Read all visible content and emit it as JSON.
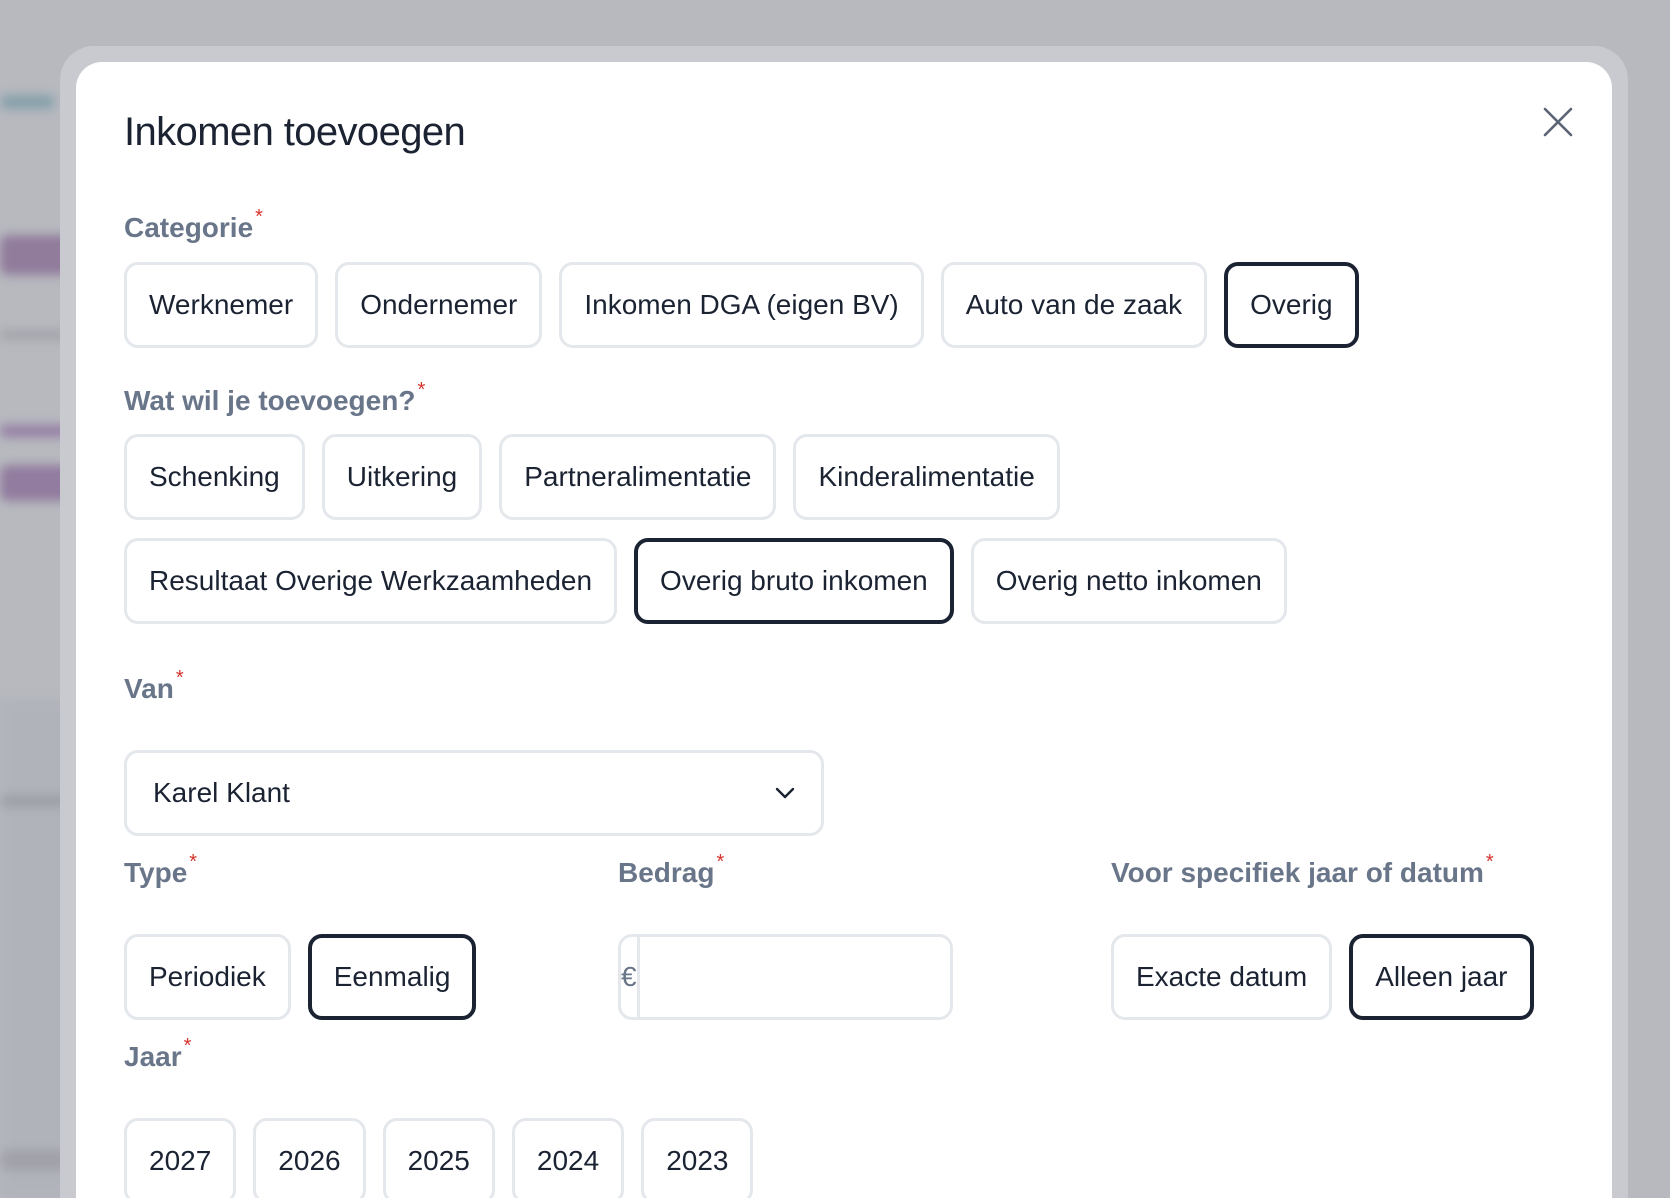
{
  "modal": {
    "title": "Inkomen toevoegen",
    "required_mark": "*"
  },
  "categorie": {
    "label": "Categorie",
    "options": [
      "Werknemer",
      "Ondernemer",
      "Inkomen DGA (eigen BV)",
      "Auto van de zaak",
      "Overig"
    ],
    "selected": "Overig"
  },
  "wat": {
    "label": "Wat wil je toevoegen?",
    "options": [
      "Schenking",
      "Uitkering",
      "Partneralimentatie",
      "Kinderalimentatie",
      "Resultaat Overige Werkzaamheden",
      "Overig bruto inkomen",
      "Overig netto inkomen"
    ],
    "selected": "Overig bruto inkomen"
  },
  "van": {
    "label": "Van",
    "value": "Karel Klant"
  },
  "type": {
    "label": "Type",
    "options": [
      "Periodiek",
      "Eenmalig"
    ],
    "selected": "Eenmalig"
  },
  "bedrag": {
    "label": "Bedrag",
    "prefix": "€",
    "value": ""
  },
  "specifiek": {
    "label": "Voor specifiek jaar of datum",
    "options": [
      "Exacte datum",
      "Alleen jaar"
    ],
    "selected": "Alleen jaar"
  },
  "jaar": {
    "label": "Jaar",
    "options": [
      "2027",
      "2026",
      "2025",
      "2024",
      "2023"
    ]
  },
  "colors": {
    "selected_border": "#1b2333",
    "border": "#e4e7ec",
    "label": "#697589",
    "required": "#d6322b"
  }
}
